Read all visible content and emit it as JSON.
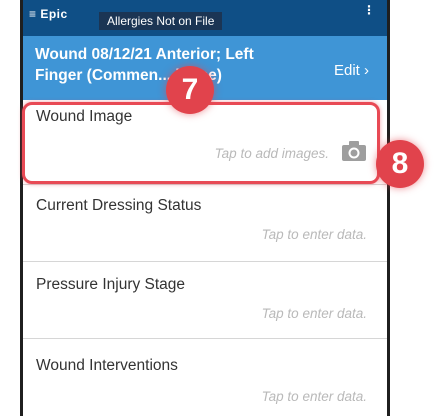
{
  "topbar": {
    "brand": "≡ Epic",
    "allergy_badge": "Allergies Not on File",
    "menu_glyph": "⋮"
  },
  "header": {
    "title": "Wound 08/12/21 Anterior; Left Finger (Commen... h one)",
    "edit_label": "Edit ›"
  },
  "sections": [
    {
      "label": "Wound Image",
      "hint": "Tap to add images."
    },
    {
      "label": "Current Dressing Status",
      "hint": "Tap to enter data."
    },
    {
      "label": "Pressure Injury Stage",
      "hint": "Tap to enter data."
    },
    {
      "label": "Wound Interventions",
      "hint": "Tap to enter data."
    }
  ],
  "callouts": {
    "first": "7",
    "second": "8"
  },
  "icons": {
    "menu": "kebab-menu-icon",
    "camera": "camera-icon"
  },
  "colors": {
    "topbar": "#0f4f86",
    "header": "#3f95d6",
    "highlight": "#e84a55",
    "callout": "#e1434c"
  }
}
